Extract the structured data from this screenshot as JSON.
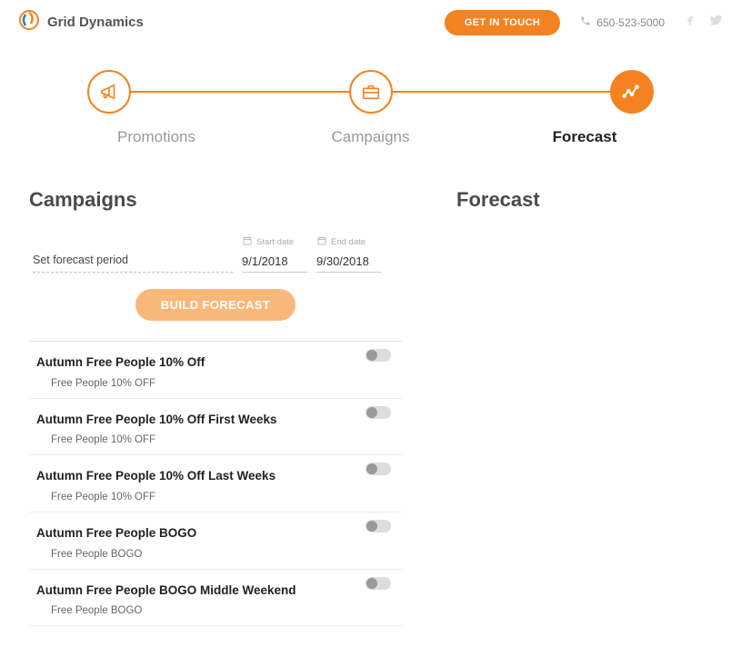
{
  "header": {
    "brand": "Grid Dynamics",
    "contact_label": "GET IN TOUCH",
    "phone": "650-523-5000"
  },
  "wizard": {
    "steps": [
      {
        "label": "Promotions",
        "active": false
      },
      {
        "label": "Campaigns",
        "active": false
      },
      {
        "label": "Forecast",
        "active": true
      }
    ]
  },
  "sections": {
    "campaigns_title": "Campaigns",
    "forecast_title": "Forecast"
  },
  "period": {
    "label": "Set forecast period",
    "start_label": "Start date",
    "end_label": "End date",
    "start_value": "9/1/2018",
    "end_value": "9/30/2018"
  },
  "actions": {
    "build_label": "BUILD FORECAST"
  },
  "campaigns": [
    {
      "title": "Autumn Free People 10% Off",
      "sub": "Free People 10% OFF",
      "enabled": false
    },
    {
      "title": "Autumn Free People 10% Off First Weeks",
      "sub": "Free People 10% OFF",
      "enabled": false
    },
    {
      "title": "Autumn Free People 10% Off Last Weeks",
      "sub": "Free People 10% OFF",
      "enabled": false
    },
    {
      "title": "Autumn Free People BOGO",
      "sub": "Free People BOGO",
      "enabled": false
    },
    {
      "title": "Autumn Free People BOGO Middle Weekend",
      "sub": "Free People BOGO",
      "enabled": false
    }
  ]
}
